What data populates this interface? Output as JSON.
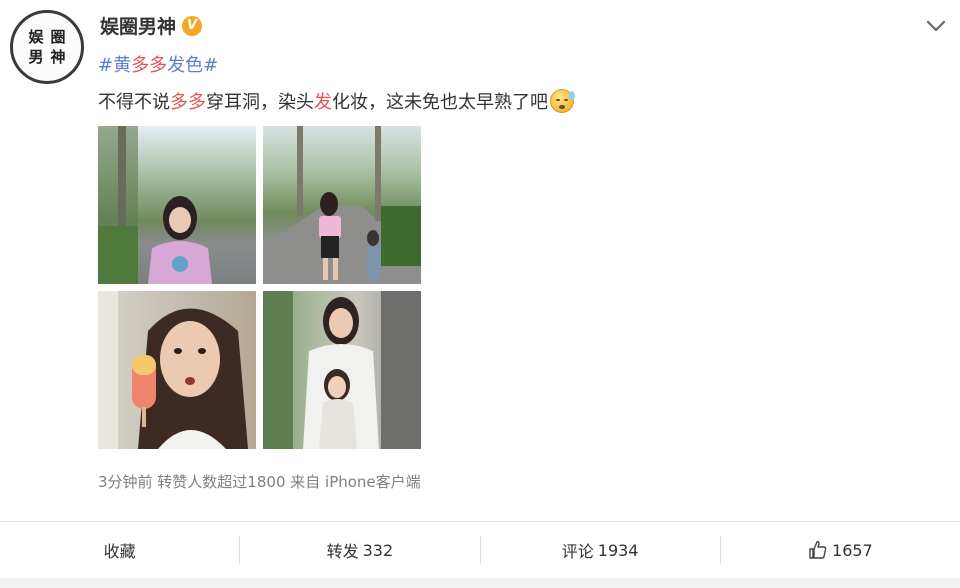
{
  "post": {
    "avatar_text": [
      "娱",
      "圈",
      "男",
      "神"
    ],
    "username": "娱圈男神",
    "verified_badge": "V",
    "topic": {
      "prefix": "#",
      "name_part1": "黄",
      "name_highlight": "多多",
      "name_part2": "发色",
      "suffix": "#"
    },
    "content": {
      "part1": "不得不说",
      "highlight1": "多多",
      "part2": "穿耳洞，染头",
      "highlight2": "发",
      "part3": "化妆，这未免也太早熟了吧",
      "emoji": "sweat-smile-emoji"
    },
    "meta": "3分钟前  转赞人数超过1800 来自 iPhone客户端"
  },
  "actions": {
    "favorite": "收藏",
    "repost_label": "转发",
    "repost_count": "332",
    "comment_label": "评论",
    "comment_count": "1934",
    "like_count": "1657"
  },
  "colors": {
    "link": "#5b7fc7",
    "highlight": "#e0555a",
    "meta": "#808080",
    "badge": "#f5a623"
  }
}
